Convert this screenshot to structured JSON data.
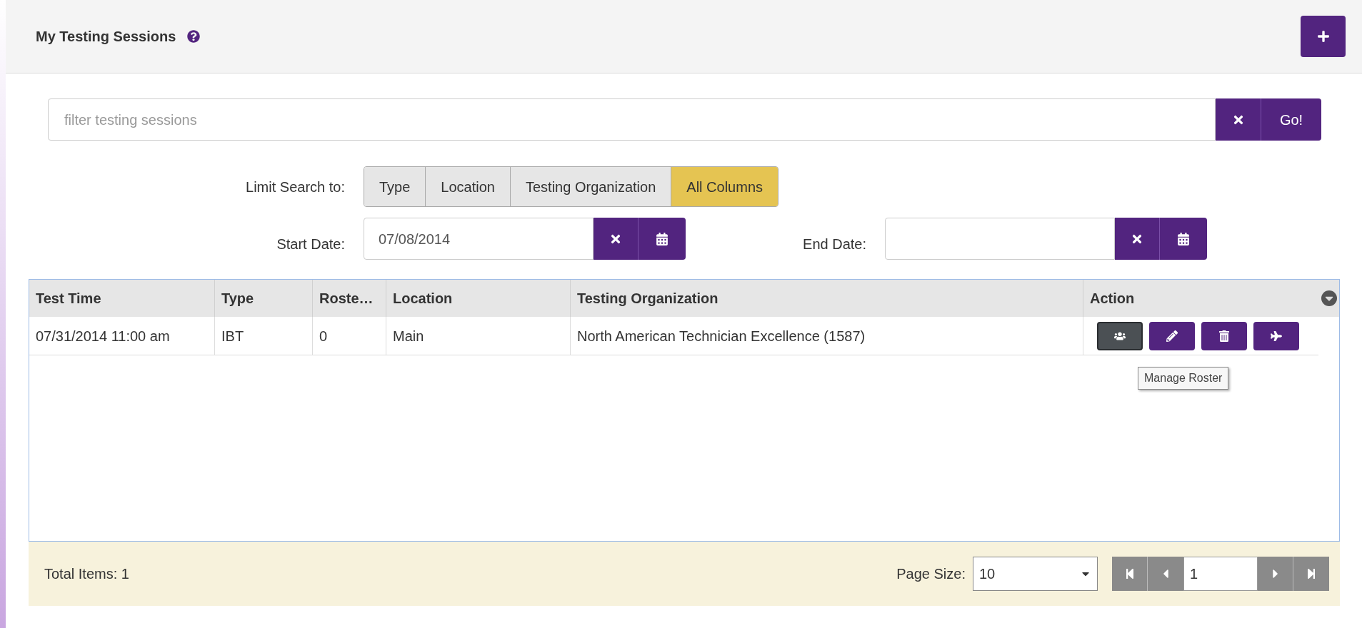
{
  "header": {
    "title": "My Testing Sessions"
  },
  "filter": {
    "placeholder": "filter testing sessions",
    "go_label": "Go!"
  },
  "limit_search": {
    "label": "Limit Search to:",
    "options": [
      {
        "label": "Type",
        "selected": false
      },
      {
        "label": "Location",
        "selected": false
      },
      {
        "label": "Testing Organization",
        "selected": false
      },
      {
        "label": "All Columns",
        "selected": true
      }
    ]
  },
  "start_date": {
    "label": "Start Date:",
    "value": "07/08/2014"
  },
  "end_date": {
    "label": "End Date:"
  },
  "table": {
    "columns": [
      "Test Time",
      "Type",
      "Roste…",
      "Location",
      "Testing Organization",
      "Action"
    ],
    "rows": [
      {
        "cells": [
          "07/31/2014 11:00 am",
          "IBT",
          "0",
          "Main",
          "North American Technician Excellence (1587)"
        ],
        "actions": [
          {
            "kind": "roster",
            "hovered": true
          },
          {
            "kind": "edit",
            "hovered": false
          },
          {
            "kind": "delete",
            "hovered": false
          },
          {
            "kind": "plane",
            "hovered": false
          }
        ]
      }
    ]
  },
  "tooltip": "Manage Roster",
  "footer": {
    "total": "Total Items: 1",
    "page_size_label": "Page Size:",
    "page_size": "10",
    "page": "1"
  }
}
